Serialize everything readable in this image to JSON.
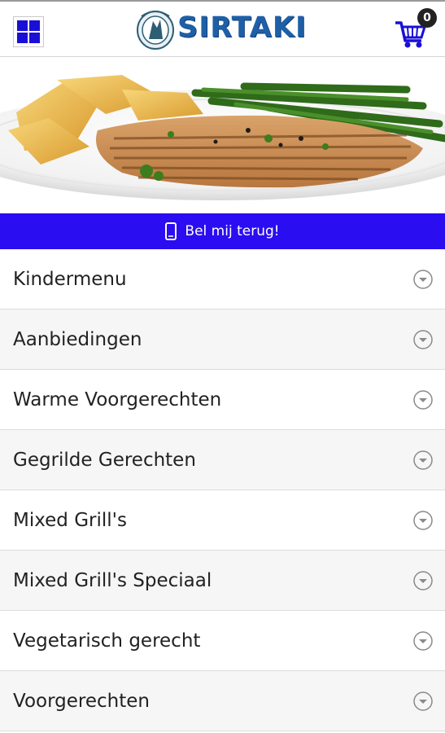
{
  "header": {
    "brand": "SIRTAKI",
    "cart_count": "0"
  },
  "callback": {
    "label": "Bel mij terug!"
  },
  "menu": {
    "items": [
      "Kindermenu",
      "Aanbiedingen",
      "Warme Voorgerechten",
      "Gegrilde Gerechten",
      "Mixed Grill's",
      "Mixed Grill's Speciaal",
      "Vegetarisch gerecht",
      "Voorgerechten"
    ]
  },
  "colors": {
    "accent": "#2a0df0",
    "brand": "#1f5fa8",
    "icon": "#1a0fd6"
  },
  "icons": {
    "menu": "grid-icon",
    "cart": "cart-icon",
    "phone": "phone-icon",
    "chevron": "chevron-down-icon"
  }
}
